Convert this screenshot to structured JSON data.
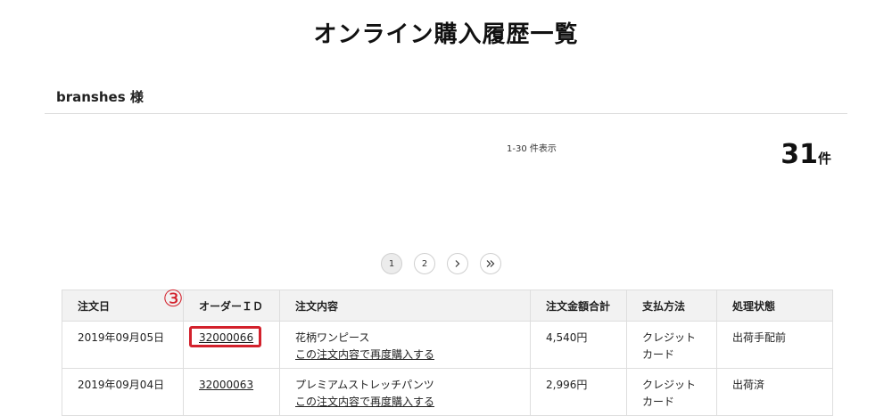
{
  "page": {
    "title": "オンライン購入履歴一覧"
  },
  "user": {
    "label": "branshes 様"
  },
  "summary": {
    "range": "1-30 件表示",
    "total_count": "31",
    "total_unit": "件"
  },
  "pagination": {
    "pages": [
      "1",
      "2"
    ],
    "next_icon": "chevron-right-icon",
    "last_icon": "double-chevron-right-icon",
    "current": "1"
  },
  "annotation": {
    "marker": "③",
    "color": "#d3212c"
  },
  "table": {
    "headers": [
      "注文日",
      "オーダーＩＤ",
      "注文内容",
      "注文金額合計",
      "支払方法",
      "処理状態"
    ],
    "rows": [
      {
        "date": "2019年09月05日",
        "order_id": "32000066",
        "item": "花柄ワンピース",
        "reorder": "この注文内容で再度購入する",
        "amount": "4,540円",
        "payment_line1": "クレジット",
        "payment_line2": "カード",
        "status": "出荷手配前"
      },
      {
        "date": "2019年09月04日",
        "order_id": "32000063",
        "item": "プレミアムストレッチパンツ",
        "reorder": "この注文内容で再度購入する",
        "amount": "2,996円",
        "payment_line1": "クレジット",
        "payment_line2": "カード",
        "status": "出荷済"
      }
    ]
  }
}
